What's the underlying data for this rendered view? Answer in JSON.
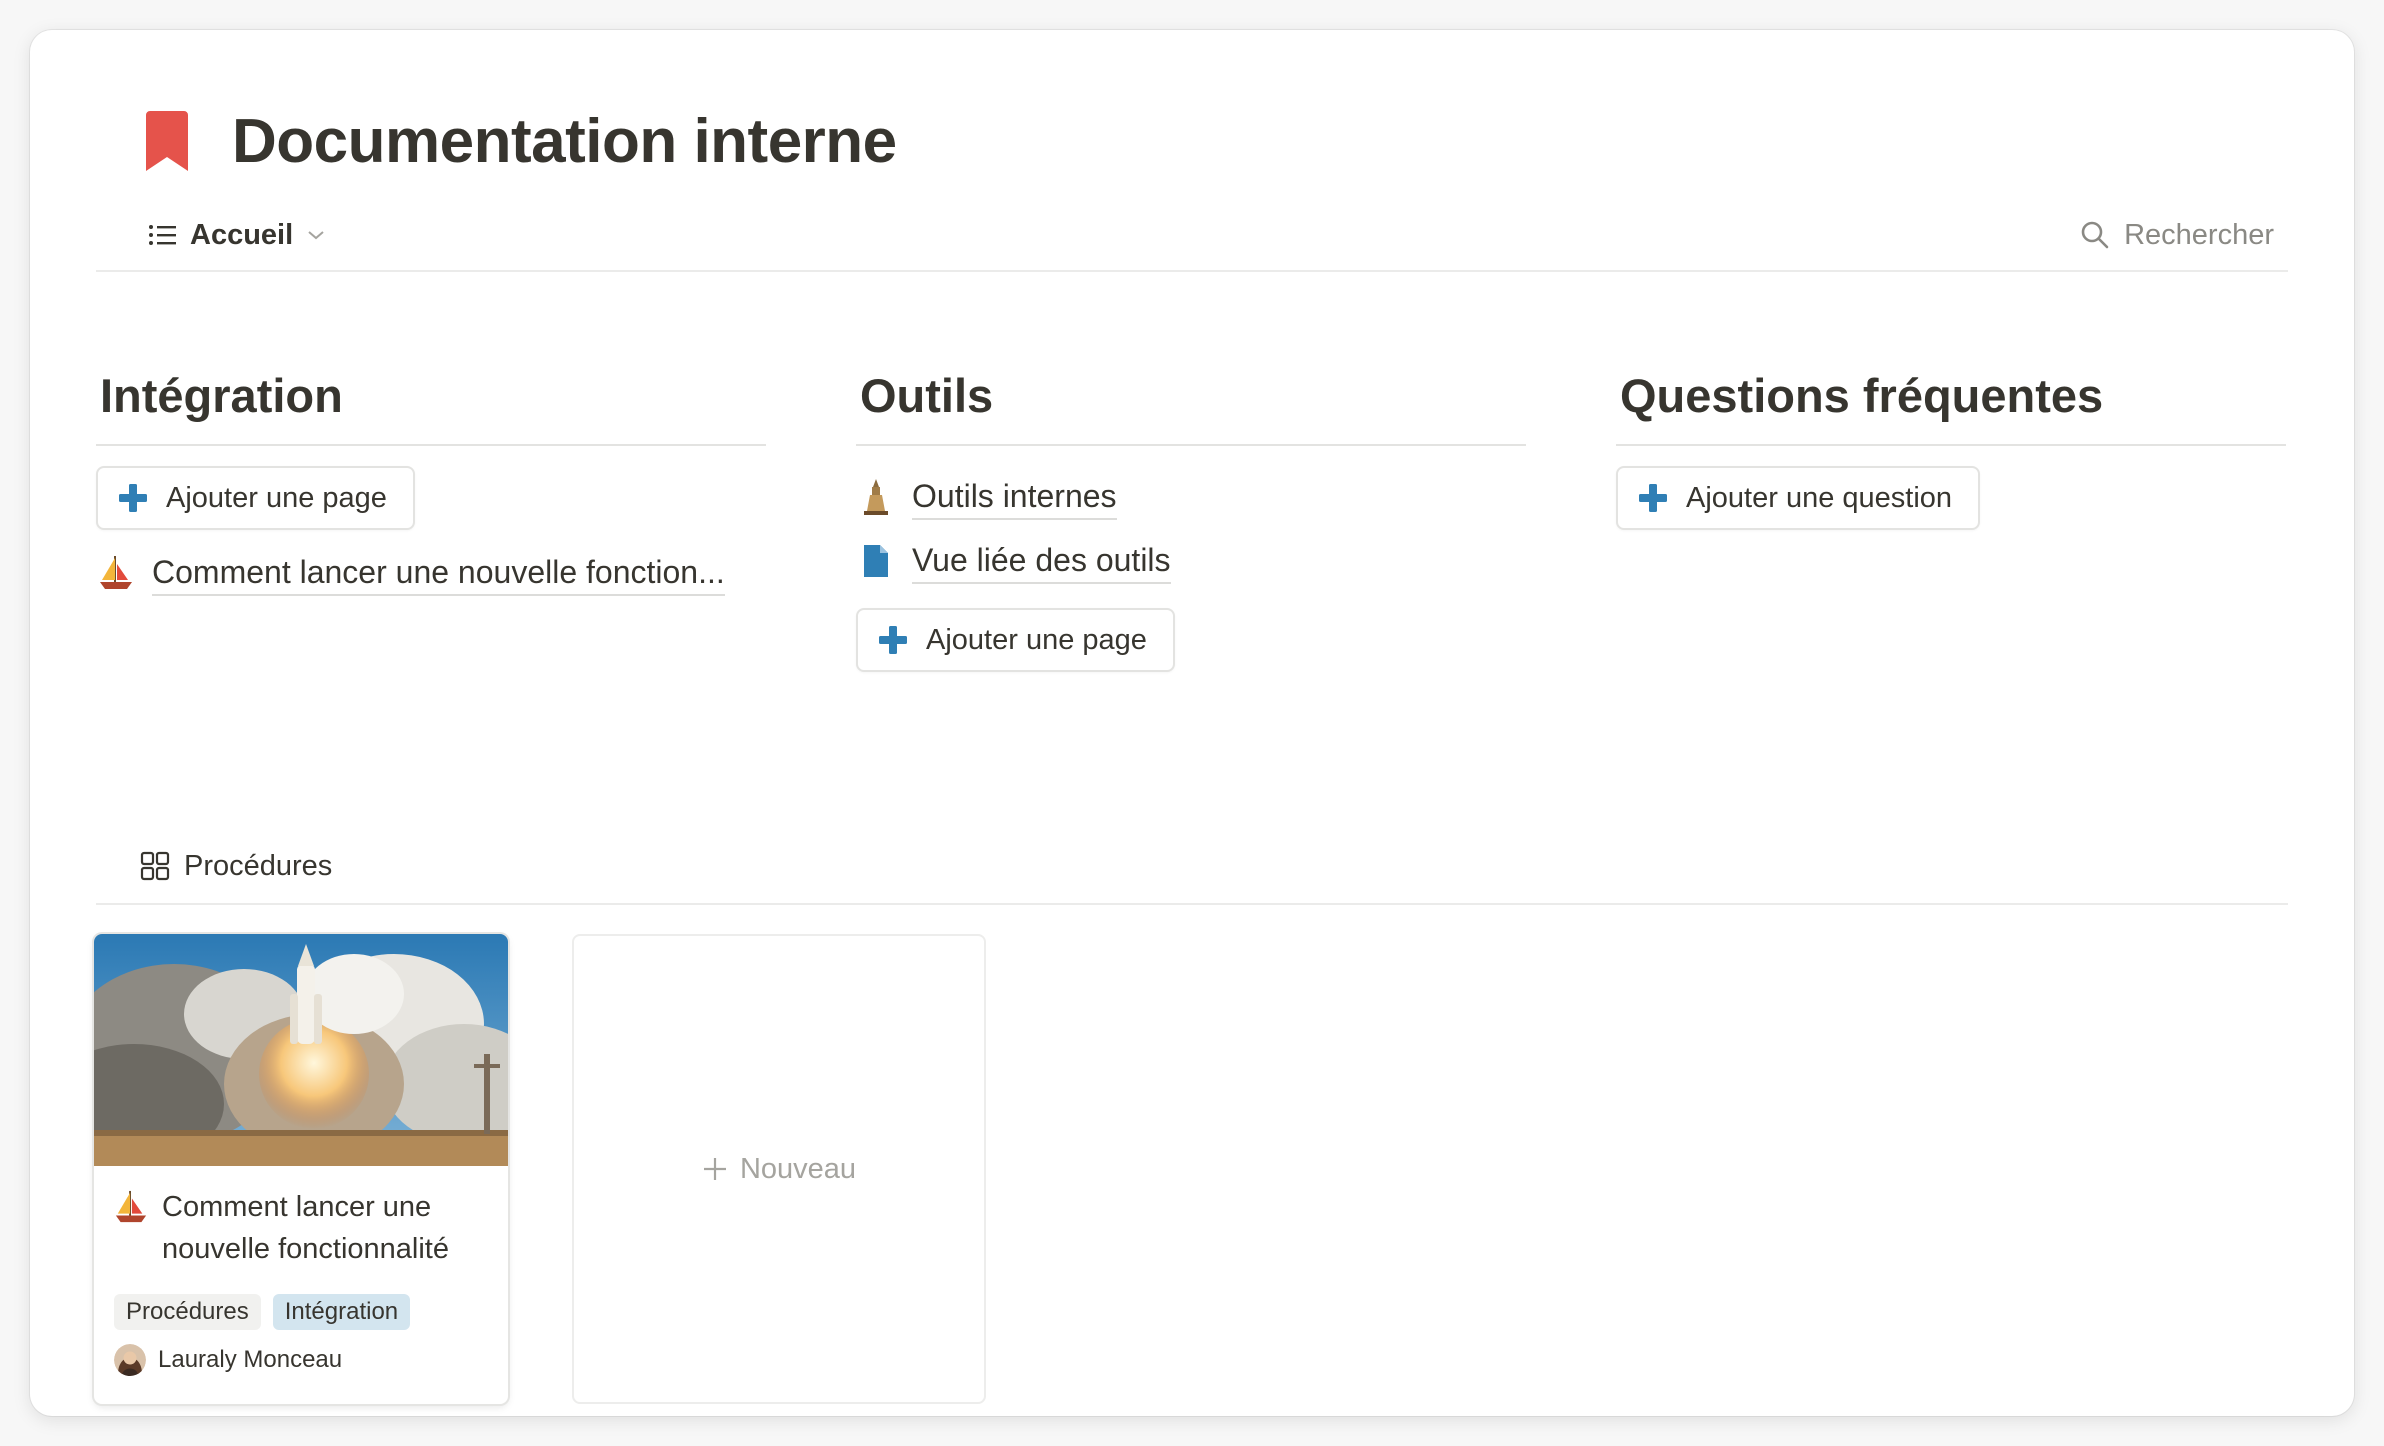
{
  "page": {
    "title": "Documentation interne",
    "icon": "bookmark-icon",
    "accent_color": "#e5534b"
  },
  "view_bar": {
    "current_view": "Accueil",
    "search_label": "Rechercher"
  },
  "columns": [
    {
      "heading": "Intégration",
      "button_label": "Ajouter une page",
      "links": [
        {
          "icon": "sailboat-icon",
          "text": "Comment lancer une nouvelle fonction..."
        }
      ]
    },
    {
      "heading": "Outils",
      "links": [
        {
          "icon": "tower-icon",
          "text": "Outils internes"
        },
        {
          "icon": "document-icon",
          "text": "Vue liée des outils"
        }
      ],
      "button_label": "Ajouter une page"
    },
    {
      "heading": "Questions fréquentes",
      "button_label": "Ajouter une question"
    }
  ],
  "database": {
    "view_label": "Procédures",
    "icon": "gallery-icon",
    "cards": [
      {
        "cover": "rocket-launch-image",
        "icon": "sailboat-icon",
        "title": "Comment lancer une nouvelle fonctionnalité",
        "tags": [
          {
            "label": "Procédures",
            "color": "#f1f1ef"
          },
          {
            "label": "Intégration",
            "color": "#d3e5ef"
          }
        ],
        "author": "Lauraly Monceau"
      }
    ],
    "new_label": "Nouveau"
  },
  "colors": {
    "plus_icon": "#2f7fb5",
    "document_icon": "#2f7fb5"
  }
}
